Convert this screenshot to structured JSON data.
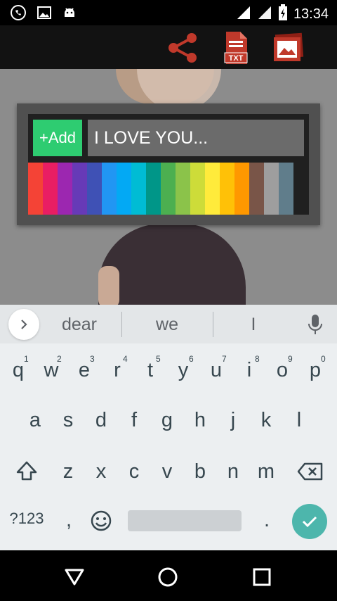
{
  "status_bar": {
    "time": "13:34",
    "left_icons": [
      "whatsapp-icon",
      "gallery-icon",
      "android-icon"
    ],
    "right_icons": [
      "wifi-icon",
      "signal-icon",
      "battery-charging-icon"
    ]
  },
  "toolbar": {
    "icons": [
      "share-icon",
      "txt-file-icon",
      "image-icon"
    ],
    "txt_label": "TXT",
    "accent": "#c0392b"
  },
  "dialog": {
    "add_label": "+Add",
    "text_value": "I LOVE YOU...",
    "palette": [
      "#f44336",
      "#e91e63",
      "#9c27b0",
      "#673ab7",
      "#3f51b5",
      "#2196f3",
      "#03a9f4",
      "#00bcd4",
      "#009688",
      "#4caf50",
      "#8bc34a",
      "#cddc39",
      "#ffeb3b",
      "#ffc107",
      "#ff9800",
      "#795548",
      "#9e9e9e",
      "#607d8b"
    ]
  },
  "keyboard": {
    "suggestions": [
      "dear",
      "we",
      "I"
    ],
    "row1": [
      "q",
      "w",
      "e",
      "r",
      "t",
      "y",
      "u",
      "i",
      "o",
      "p"
    ],
    "row1_hints": [
      "1",
      "2",
      "3",
      "4",
      "5",
      "6",
      "7",
      "8",
      "9",
      "0"
    ],
    "row2": [
      "a",
      "s",
      "d",
      "f",
      "g",
      "h",
      "j",
      "k",
      "l"
    ],
    "row3": [
      "z",
      "x",
      "c",
      "v",
      "b",
      "n",
      "m"
    ],
    "symbols_label": "?123",
    "comma": ",",
    "period": "."
  }
}
